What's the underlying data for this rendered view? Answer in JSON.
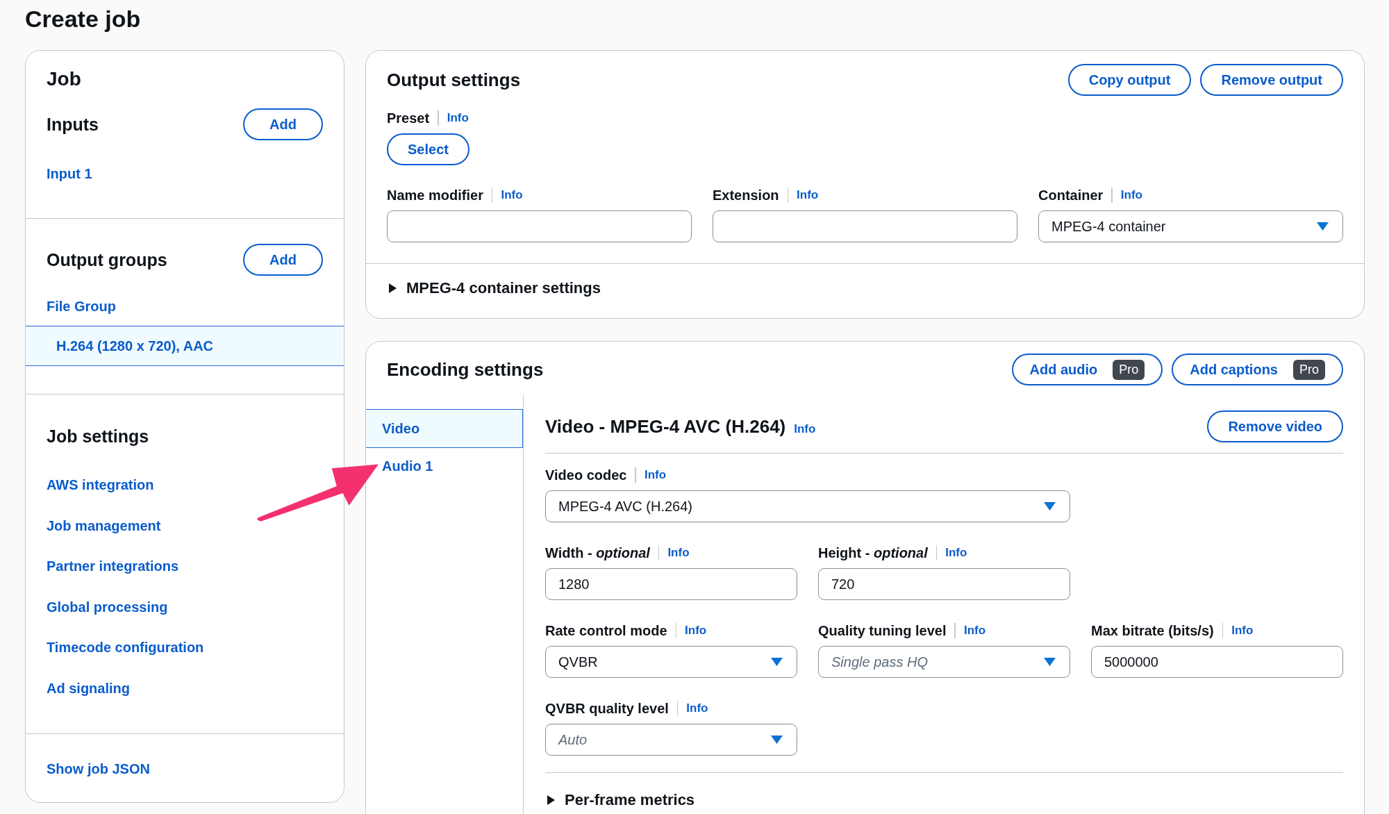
{
  "page": {
    "title": "Create job"
  },
  "sidebar": {
    "title": "Job",
    "inputs": {
      "title": "Inputs",
      "add_button": "Add",
      "items": [
        {
          "label": "Input 1",
          "selected": false
        }
      ]
    },
    "output_groups": {
      "title": "Output groups",
      "add_button": "Add",
      "groups": [
        {
          "label": "File Group",
          "outputs": [
            {
              "label": "H.264 (1280 x 720), AAC",
              "selected": true
            }
          ]
        }
      ]
    },
    "job_settings": {
      "title": "Job settings",
      "links": [
        "AWS integration",
        "Job management",
        "Partner integrations",
        "Global processing",
        "Timecode configuration",
        "Ad signaling"
      ]
    },
    "footer_link": "Show job JSON"
  },
  "output_settings": {
    "title": "Output settings",
    "buttons": [
      "Copy output",
      "Remove output"
    ],
    "preset": {
      "label": "Preset",
      "info": "Info",
      "button": "Select"
    },
    "fields": [
      {
        "kind": "input",
        "label": "Name modifier",
        "info": "Info"
      },
      {
        "kind": "input",
        "label": "Extension",
        "info": "Info"
      },
      {
        "kind": "select",
        "label": "Container",
        "info": "Info",
        "value": "MPEG-4 container"
      }
    ],
    "expander": {
      "label": "MPEG-4 container settings",
      "expanded": false
    }
  },
  "encoding_settings": {
    "title": "Encoding settings",
    "buttons": [
      {
        "label": "Add audio",
        "badge": "Pro"
      },
      {
        "label": "Add captions",
        "badge": "Pro"
      }
    ],
    "tabs": [
      {
        "label": "Video",
        "selected": true
      },
      {
        "label": "Audio 1",
        "selected": false
      }
    ],
    "video": {
      "title": "Video - MPEG-4 AVC (H.264)",
      "info": "Info",
      "remove_button": "Remove video",
      "rows": [
        [
          {
            "kind": "select",
            "label": "Video codec",
            "info": "Info",
            "value": "MPEG-4 AVC (H.264)"
          }
        ],
        [
          {
            "kind": "input",
            "label": "Width - *optional*",
            "info": "Info",
            "value": "1280"
          },
          {
            "kind": "input",
            "label": "Height - *optional*",
            "info": "Info",
            "value": "720"
          }
        ],
        [
          {
            "kind": "select",
            "label": "Rate control mode",
            "info": "Info",
            "value": "QVBR"
          },
          {
            "kind": "select",
            "label": "Quality tuning level",
            "info": "Info",
            "placeholder": "Single pass HQ"
          },
          {
            "kind": "input",
            "label": "Max bitrate (bits/s)",
            "info": "Info",
            "value": "5000000"
          }
        ],
        [
          {
            "kind": "select",
            "label": "QVBR quality level",
            "info": "Info",
            "placeholder": "Auto"
          }
        ]
      ],
      "expander": {
        "label": "Per-frame metrics",
        "expanded": false
      }
    }
  }
}
